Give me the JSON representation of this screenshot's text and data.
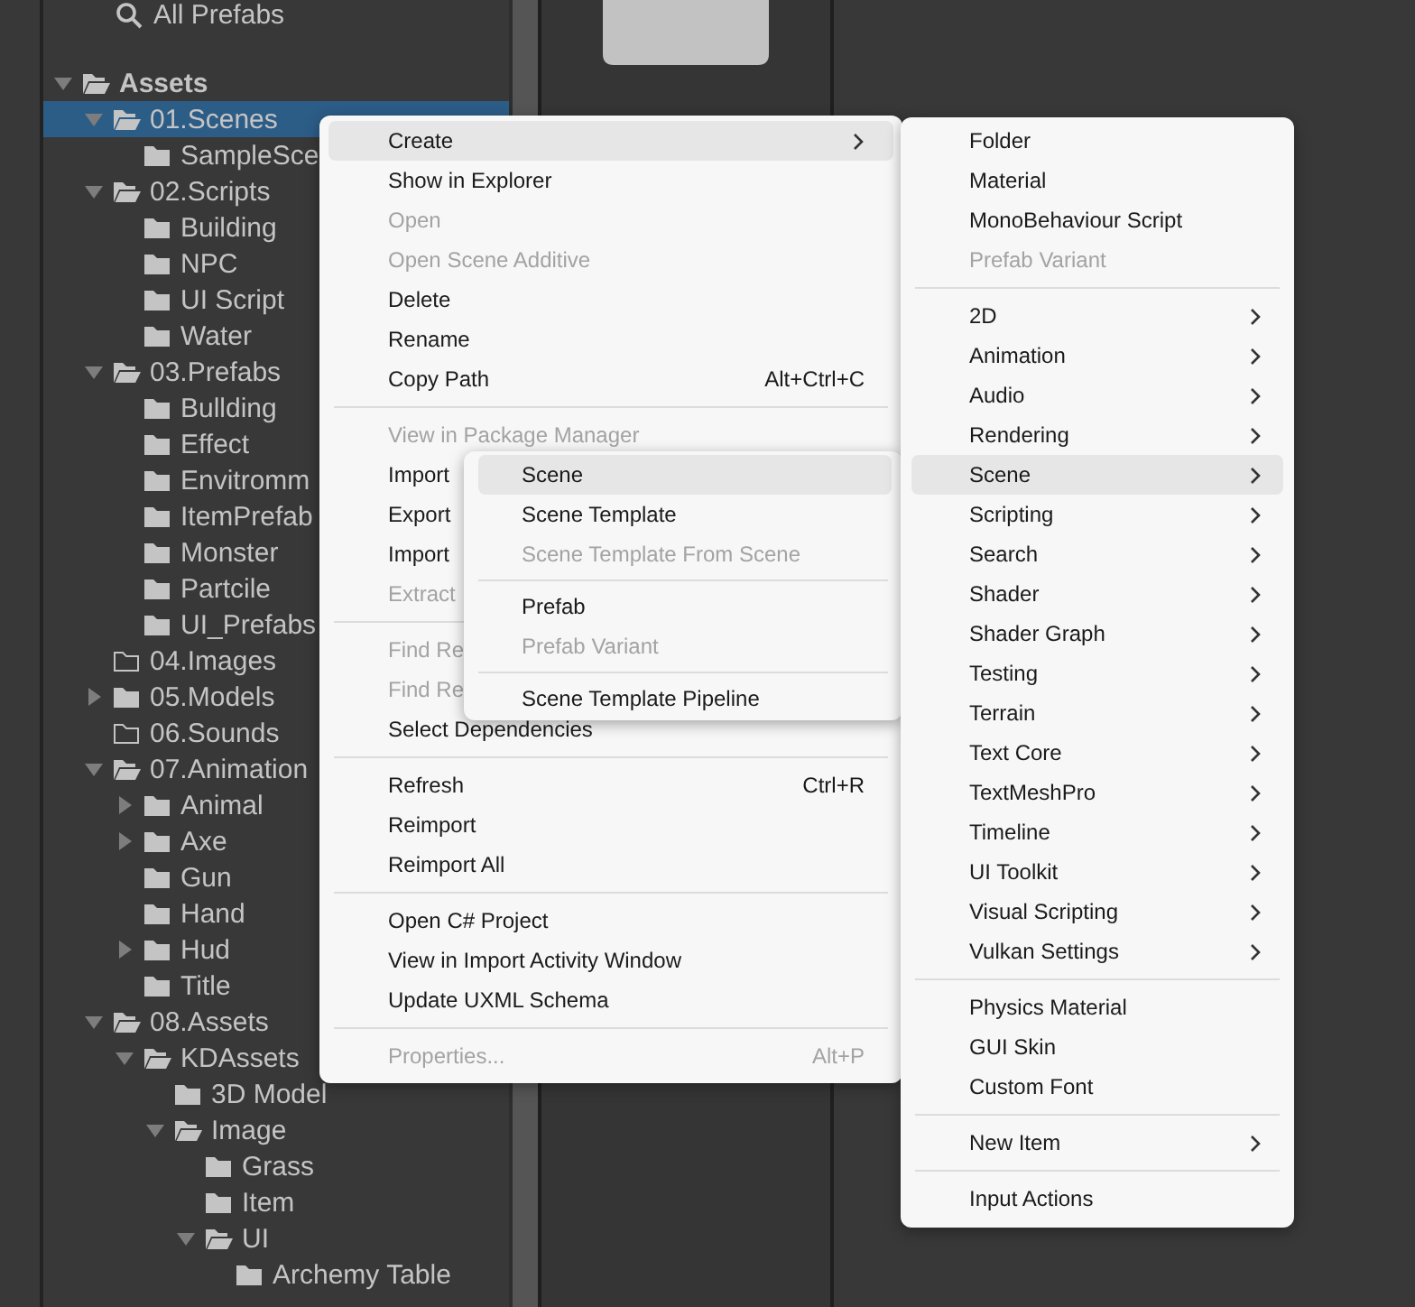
{
  "tree": {
    "favorites": [
      {
        "label": "All Prefabs"
      }
    ],
    "items": [
      {
        "label": "Assets",
        "kind": "expanded",
        "selected": false,
        "children": [
          {
            "label": "01.Scenes",
            "kind": "expanded",
            "selected": true,
            "children": [
              {
                "label": "SampleSce",
                "kind": "leaf",
                "selected": false
              }
            ]
          },
          {
            "label": "02.Scripts",
            "kind": "expanded",
            "selected": false,
            "children": [
              {
                "label": "Building",
                "kind": "leaf",
                "selected": false
              },
              {
                "label": "NPC",
                "kind": "leaf",
                "selected": false
              },
              {
                "label": "UI Script",
                "kind": "leaf",
                "selected": false
              },
              {
                "label": "Water",
                "kind": "leaf",
                "selected": false
              }
            ]
          },
          {
            "label": "03.Prefabs",
            "kind": "expanded",
            "selected": false,
            "children": [
              {
                "label": "Bullding",
                "kind": "leaf",
                "selected": false
              },
              {
                "label": "Effect",
                "kind": "leaf",
                "selected": false
              },
              {
                "label": "Envitromm",
                "kind": "leaf",
                "selected": false
              },
              {
                "label": "ItemPrefab",
                "kind": "leaf",
                "selected": false
              },
              {
                "label": "Monster",
                "kind": "leaf",
                "selected": false
              },
              {
                "label": "Partcile",
                "kind": "leaf",
                "selected": false
              },
              {
                "label": "UI_Prefabs",
                "kind": "leaf",
                "selected": false
              }
            ]
          },
          {
            "label": "04.Images",
            "kind": "empty",
            "selected": false
          },
          {
            "label": "05.Models",
            "kind": "collapsed",
            "selected": false
          },
          {
            "label": "06.Sounds",
            "kind": "empty",
            "selected": false
          },
          {
            "label": "07.Animation",
            "kind": "expanded",
            "selected": false,
            "children": [
              {
                "label": "Animal",
                "kind": "collapsed",
                "selected": false
              },
              {
                "label": "Axe",
                "kind": "collapsed",
                "selected": false
              },
              {
                "label": "Gun",
                "kind": "leaf",
                "selected": false
              },
              {
                "label": "Hand",
                "kind": "leaf",
                "selected": false
              },
              {
                "label": "Hud",
                "kind": "collapsed",
                "selected": false
              },
              {
                "label": "Title",
                "kind": "leaf",
                "selected": false
              }
            ]
          },
          {
            "label": "08.Assets",
            "kind": "expanded",
            "selected": false,
            "children": [
              {
                "label": "KDAssets",
                "kind": "expanded",
                "selected": false,
                "children": [
                  {
                    "label": "3D Model",
                    "kind": "leaf",
                    "selected": false
                  },
                  {
                    "label": "Image",
                    "kind": "expanded",
                    "selected": false,
                    "children": [
                      {
                        "label": "Grass",
                        "kind": "leaf",
                        "selected": false
                      },
                      {
                        "label": "Item",
                        "kind": "leaf",
                        "selected": false
                      },
                      {
                        "label": "UI",
                        "kind": "expanded",
                        "selected": false,
                        "children": [
                          {
                            "label": "Archemy Table",
                            "kind": "leaf",
                            "selected": false
                          }
                        ]
                      }
                    ]
                  }
                ]
              }
            ]
          }
        ]
      }
    ]
  },
  "context_menu": {
    "items": [
      {
        "kind": "item",
        "label": "Create",
        "selected": true,
        "disabled": false,
        "submenu": true
      },
      {
        "kind": "item",
        "label": "Show in Explorer",
        "selected": false,
        "disabled": false,
        "submenu": false
      },
      {
        "kind": "item",
        "label": "Open",
        "selected": false,
        "disabled": true,
        "submenu": false
      },
      {
        "kind": "item",
        "label": "Open Scene Additive",
        "selected": false,
        "disabled": true,
        "submenu": false
      },
      {
        "kind": "item",
        "label": "Delete",
        "selected": false,
        "disabled": false,
        "submenu": false
      },
      {
        "kind": "item",
        "label": "Rename",
        "selected": false,
        "disabled": false,
        "submenu": false
      },
      {
        "kind": "item",
        "label": "Copy Path",
        "shortcut": "Alt+Ctrl+C",
        "selected": false,
        "disabled": false,
        "submenu": false
      },
      {
        "kind": "separator"
      },
      {
        "kind": "item",
        "label": "View in Package Manager",
        "selected": false,
        "disabled": true,
        "submenu": false
      },
      {
        "kind": "item",
        "label": "Import",
        "selected": false,
        "disabled": false,
        "submenu": false
      },
      {
        "kind": "item",
        "label": "Export",
        "selected": false,
        "disabled": false,
        "submenu": false
      },
      {
        "kind": "item",
        "label": "Import",
        "selected": false,
        "disabled": false,
        "submenu": false
      },
      {
        "kind": "item",
        "label": "Extract",
        "selected": false,
        "disabled": true,
        "submenu": false
      },
      {
        "kind": "separator"
      },
      {
        "kind": "item",
        "label": "Find Re",
        "selected": false,
        "disabled": true,
        "submenu": false
      },
      {
        "kind": "item",
        "label": "Find Re",
        "selected": false,
        "disabled": true,
        "submenu": false
      },
      {
        "kind": "item",
        "label": "Select Dependencies",
        "selected": false,
        "disabled": false,
        "submenu": false
      },
      {
        "kind": "separator"
      },
      {
        "kind": "item",
        "label": "Refresh",
        "shortcut": "Ctrl+R",
        "selected": false,
        "disabled": false,
        "submenu": false
      },
      {
        "kind": "item",
        "label": "Reimport",
        "selected": false,
        "disabled": false,
        "submenu": false
      },
      {
        "kind": "item",
        "label": "Reimport All",
        "selected": false,
        "disabled": false,
        "submenu": false
      },
      {
        "kind": "separator"
      },
      {
        "kind": "item",
        "label": "Open C# Project",
        "selected": false,
        "disabled": false,
        "submenu": false
      },
      {
        "kind": "item",
        "label": "View in Import Activity Window",
        "selected": false,
        "disabled": false,
        "submenu": false
      },
      {
        "kind": "item",
        "label": "Update UXML Schema",
        "selected": false,
        "disabled": false,
        "submenu": false
      },
      {
        "kind": "separator"
      },
      {
        "kind": "item",
        "label": "Properties...",
        "shortcut": "Alt+P",
        "selected": false,
        "disabled": true,
        "submenu": false
      }
    ]
  },
  "create_submenu": {
    "items": [
      {
        "kind": "item",
        "label": "Folder",
        "selected": false,
        "disabled": false,
        "submenu": false
      },
      {
        "kind": "item",
        "label": "Material",
        "selected": false,
        "disabled": false,
        "submenu": false
      },
      {
        "kind": "item",
        "label": "MonoBehaviour Script",
        "selected": false,
        "disabled": false,
        "submenu": false
      },
      {
        "kind": "item",
        "label": "Prefab Variant",
        "selected": false,
        "disabled": true,
        "submenu": false
      },
      {
        "kind": "separator"
      },
      {
        "kind": "item",
        "label": "2D",
        "selected": false,
        "disabled": false,
        "submenu": true
      },
      {
        "kind": "item",
        "label": "Animation",
        "selected": false,
        "disabled": false,
        "submenu": true
      },
      {
        "kind": "item",
        "label": "Audio",
        "selected": false,
        "disabled": false,
        "submenu": true
      },
      {
        "kind": "item",
        "label": "Rendering",
        "selected": false,
        "disabled": false,
        "submenu": true
      },
      {
        "kind": "item",
        "label": "Scene",
        "selected": true,
        "disabled": false,
        "submenu": true
      },
      {
        "kind": "item",
        "label": "Scripting",
        "selected": false,
        "disabled": false,
        "submenu": true
      },
      {
        "kind": "item",
        "label": "Search",
        "selected": false,
        "disabled": false,
        "submenu": true
      },
      {
        "kind": "item",
        "label": "Shader",
        "selected": false,
        "disabled": false,
        "submenu": true
      },
      {
        "kind": "item",
        "label": "Shader Graph",
        "selected": false,
        "disabled": false,
        "submenu": true
      },
      {
        "kind": "item",
        "label": "Testing",
        "selected": false,
        "disabled": false,
        "submenu": true
      },
      {
        "kind": "item",
        "label": "Terrain",
        "selected": false,
        "disabled": false,
        "submenu": true
      },
      {
        "kind": "item",
        "label": "Text Core",
        "selected": false,
        "disabled": false,
        "submenu": true
      },
      {
        "kind": "item",
        "label": "TextMeshPro",
        "selected": false,
        "disabled": false,
        "submenu": true
      },
      {
        "kind": "item",
        "label": "Timeline",
        "selected": false,
        "disabled": false,
        "submenu": true
      },
      {
        "kind": "item",
        "label": "UI Toolkit",
        "selected": false,
        "disabled": false,
        "submenu": true
      },
      {
        "kind": "item",
        "label": "Visual Scripting",
        "selected": false,
        "disabled": false,
        "submenu": true
      },
      {
        "kind": "item",
        "label": "Vulkan Settings",
        "selected": false,
        "disabled": false,
        "submenu": true
      },
      {
        "kind": "separator"
      },
      {
        "kind": "item",
        "label": "Physics Material",
        "selected": false,
        "disabled": false,
        "submenu": false
      },
      {
        "kind": "item",
        "label": "GUI Skin",
        "selected": false,
        "disabled": false,
        "submenu": false
      },
      {
        "kind": "item",
        "label": "Custom Font",
        "selected": false,
        "disabled": false,
        "submenu": false
      },
      {
        "kind": "separator"
      },
      {
        "kind": "item",
        "label": "New Item",
        "selected": false,
        "disabled": false,
        "submenu": true
      },
      {
        "kind": "separator"
      },
      {
        "kind": "item",
        "label": "Input Actions",
        "selected": false,
        "disabled": false,
        "submenu": false
      }
    ]
  },
  "scene_submenu": {
    "items": [
      {
        "kind": "item",
        "label": "Scene",
        "selected": true,
        "disabled": false,
        "submenu": false
      },
      {
        "kind": "item",
        "label": "Scene Template",
        "selected": false,
        "disabled": false,
        "submenu": false
      },
      {
        "kind": "item",
        "label": "Scene Template From Scene",
        "selected": false,
        "disabled": true,
        "submenu": false
      },
      {
        "kind": "separator"
      },
      {
        "kind": "item",
        "label": "Prefab",
        "selected": false,
        "disabled": false,
        "submenu": false
      },
      {
        "kind": "item",
        "label": "Prefab Variant",
        "selected": false,
        "disabled": true,
        "submenu": false
      },
      {
        "kind": "separator"
      },
      {
        "kind": "item",
        "label": "Scene Template Pipeline",
        "selected": false,
        "disabled": false,
        "submenu": false
      }
    ]
  }
}
